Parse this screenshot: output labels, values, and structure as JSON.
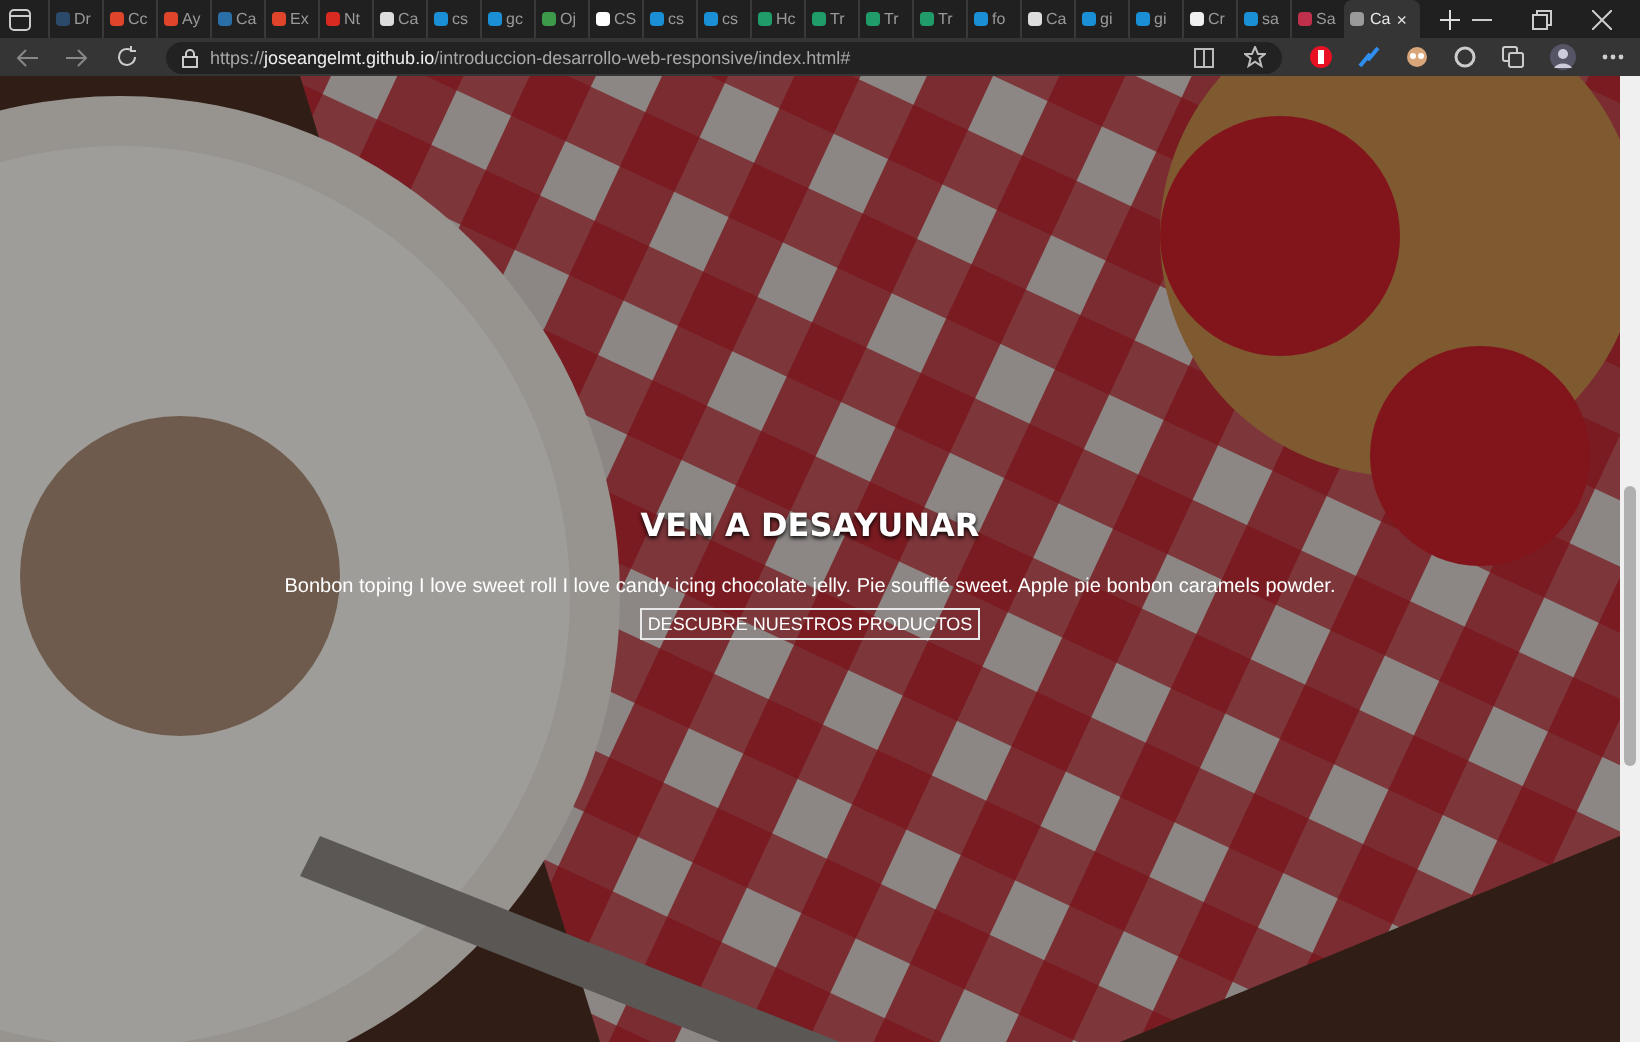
{
  "tabs": [
    {
      "title": "Dr",
      "color": "#2b4a6b",
      "selected": false
    },
    {
      "title": "Cc",
      "color": "#e0452c",
      "selected": false
    },
    {
      "title": "Ay",
      "color": "#e0452c",
      "selected": false
    },
    {
      "title": "Ca",
      "color": "#2a6fa8",
      "selected": false
    },
    {
      "title": "Ex",
      "color": "#e0452c",
      "selected": false
    },
    {
      "title": "Nt",
      "color": "#d82a20",
      "selected": false
    },
    {
      "title": "Ca",
      "color": "#dddddd",
      "selected": false
    },
    {
      "title": "cs",
      "color": "#1a8fd6",
      "selected": false
    },
    {
      "title": "gc",
      "color": "#1a8fd6",
      "selected": false
    },
    {
      "title": "Oj",
      "color": "#3c9a4a",
      "selected": false
    },
    {
      "title": "CS",
      "color": "#ffffff",
      "selected": false
    },
    {
      "title": "cs",
      "color": "#1a8fd6",
      "selected": false
    },
    {
      "title": "cs",
      "color": "#1a8fd6",
      "selected": false
    },
    {
      "title": "Hc",
      "color": "#1f9c6a",
      "selected": false
    },
    {
      "title": "Tr",
      "color": "#1f9c6a",
      "selected": false
    },
    {
      "title": "Tr",
      "color": "#1f9c6a",
      "selected": false
    },
    {
      "title": "Tr",
      "color": "#1f9c6a",
      "selected": false
    },
    {
      "title": "fo",
      "color": "#1a8fd6",
      "selected": false
    },
    {
      "title": "Ca",
      "color": "#dddddd",
      "selected": false
    },
    {
      "title": "gi",
      "color": "#1a8fd6",
      "selected": false
    },
    {
      "title": "gi",
      "color": "#1a8fd6",
      "selected": false
    },
    {
      "title": "Cr",
      "color": "#f0f0f0",
      "selected": false
    },
    {
      "title": "sa",
      "color": "#1a8fd6",
      "selected": false
    },
    {
      "title": "Sa",
      "color": "#c0304a",
      "selected": false
    },
    {
      "title": "Ca",
      "color": "#9a9a9a",
      "selected": true,
      "close": "×"
    }
  ],
  "address_bar": {
    "url": "https://**joseangelmt.github.io**/introduccion-desarrollo-web-responsive/index.html#"
  },
  "hero": {
    "title": "VEN A DESAYUNAR",
    "text": "Bonbon toping I love sweet roll I love candy icing chocolate jelly. Pie soufflé sweet. Apple pie bonbon caramels powder.",
    "button": "DESCUBRE NUESTROS PRODUCTOS"
  }
}
